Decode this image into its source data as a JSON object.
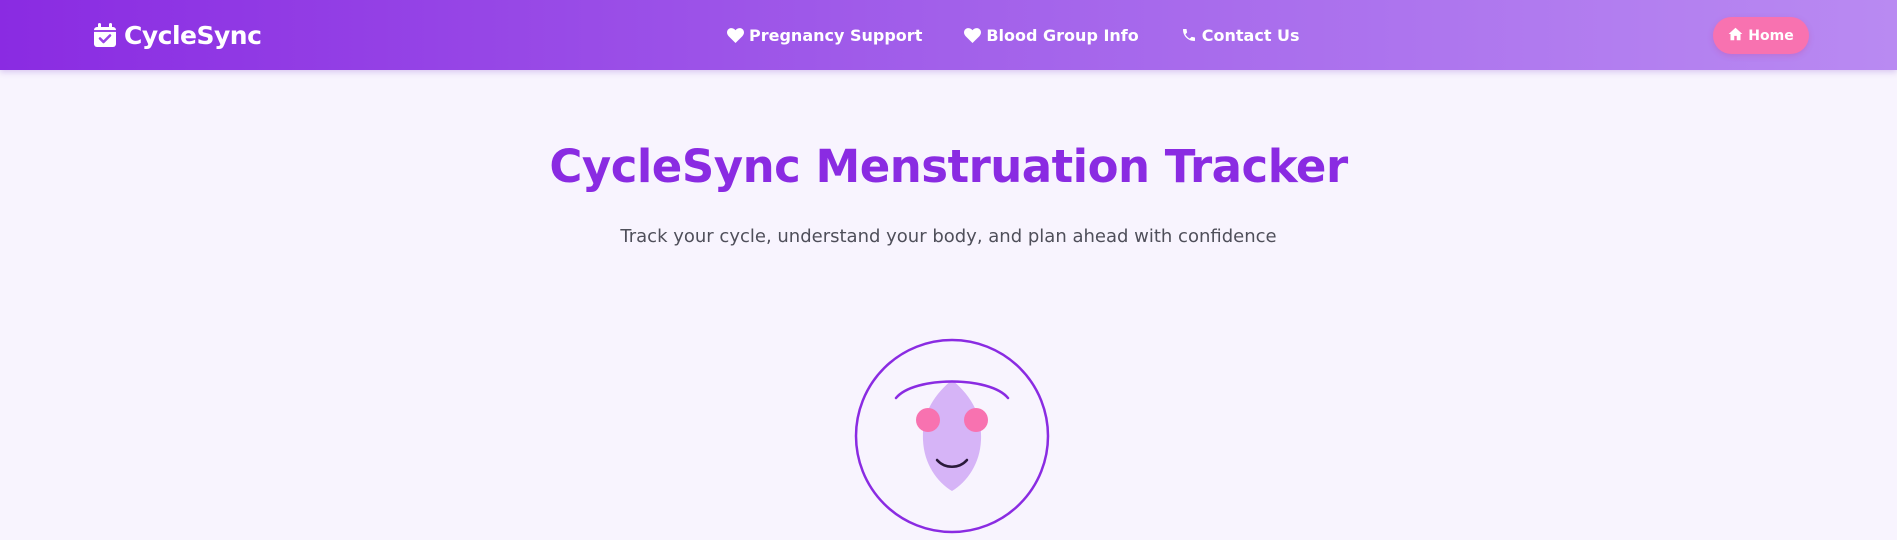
{
  "navbar": {
    "brand": "CycleSync",
    "brand_icon": "calendar-check-icon",
    "links": [
      {
        "label": "Pregnancy Support",
        "icon": "heart-icon"
      },
      {
        "label": "Blood Group Info",
        "icon": "heart-icon"
      },
      {
        "label": "Contact Us",
        "icon": "phone-icon"
      }
    ],
    "home_button": {
      "label": "Home",
      "icon": "home-icon"
    }
  },
  "hero": {
    "title": "CycleSync Menstruation Tracker",
    "subtitle": "Track your cycle, understand your body, and plan ahead with confidence"
  },
  "colors": {
    "primary": "#8a2be2",
    "navbar_end": "#b98af2",
    "accent_pink": "#f872b0",
    "background": "#f8f4fe",
    "face_fill": "#d6b4f7"
  }
}
